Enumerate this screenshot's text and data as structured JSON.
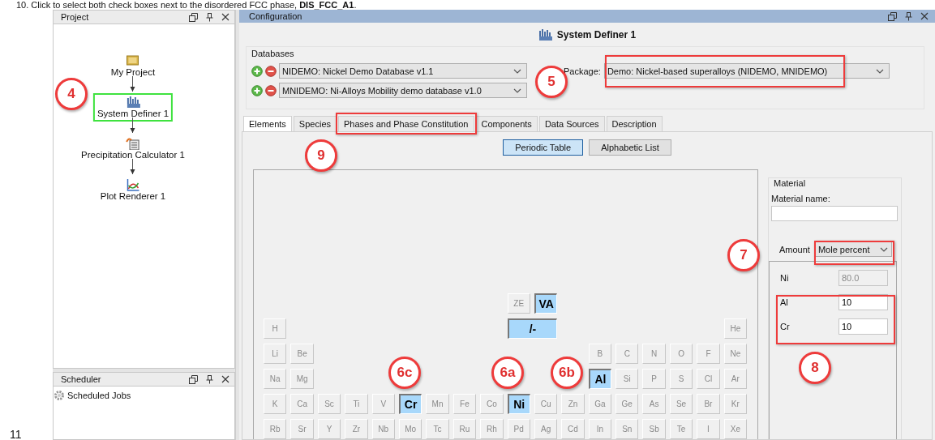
{
  "instruction_text": "10. Click to select both check boxes next to the disordered FCC phase, **DIS_FCC_A1**.",
  "page_number": "11",
  "project_panel": {
    "title": "Project",
    "nodes": [
      {
        "label": "My Project",
        "kind": "project",
        "selected": false
      },
      {
        "label": "System Definer 1",
        "kind": "definer",
        "selected": true
      },
      {
        "label": "Precipitation Calculator 1",
        "kind": "calculator",
        "selected": false
      },
      {
        "label": "Plot Renderer 1",
        "kind": "plot",
        "selected": false
      }
    ]
  },
  "scheduler_panel": {
    "title": "Scheduler",
    "items": [
      "Scheduled Jobs"
    ]
  },
  "configuration_panel": {
    "title": "Configuration",
    "header": "System Definer 1",
    "databases": {
      "title": "Databases",
      "rows": [
        {
          "value": "NIDEMO: Nickel Demo Database v1.1"
        },
        {
          "value": "MNIDEMO: Ni-Alloys Mobility demo database v1.0"
        }
      ]
    },
    "package": {
      "label": "Package:",
      "value": "Demo: Nickel-based superalloys (NIDEMO, MNIDEMO)"
    },
    "tabs": [
      {
        "label": "Elements",
        "selected": true
      },
      {
        "label": "Species",
        "selected": false
      },
      {
        "label": "Phases and Phase Constitution",
        "selected": false
      },
      {
        "label": "Components",
        "selected": false
      },
      {
        "label": "Data Sources",
        "selected": false
      },
      {
        "label": "Description",
        "selected": false
      }
    ],
    "view_buttons": [
      {
        "label": "Periodic Table",
        "selected": true
      },
      {
        "label": "Alphabetic List",
        "selected": false
      }
    ],
    "periodic_table": {
      "rows": [
        [
          "",
          "",
          "",
          "",
          "",
          "",
          "",
          "",
          "",
          {
            "symbol": "ZE",
            "kind": "special",
            "selected": false
          },
          {
            "symbol": "VA",
            "kind": "special",
            "selected": true
          }
        ],
        [
          {
            "symbol": "H",
            "kind": "element",
            "selected": false
          },
          "",
          "",
          "",
          "",
          "",
          "",
          "",
          "",
          {
            "symbol": "/-",
            "kind": "wide",
            "selected": true
          },
          "",
          "",
          "",
          "",
          "",
          "",
          "",
          {
            "symbol": "He",
            "kind": "element",
            "selected": false
          }
        ],
        [
          {
            "symbol": "Li",
            "kind": "element",
            "selected": false
          },
          {
            "symbol": "Be",
            "kind": "element",
            "selected": false
          },
          "",
          "",
          "",
          "",
          "",
          "",
          "",
          "",
          "",
          "",
          {
            "symbol": "B",
            "kind": "element",
            "selected": false
          },
          {
            "symbol": "C",
            "kind": "element",
            "selected": false
          },
          {
            "symbol": "N",
            "kind": "element",
            "selected": false
          },
          {
            "symbol": "O",
            "kind": "element",
            "selected": false
          },
          {
            "symbol": "F",
            "kind": "element",
            "selected": false
          },
          {
            "symbol": "Ne",
            "kind": "element",
            "selected": false
          }
        ],
        [
          {
            "symbol": "Na",
            "kind": "element",
            "selected": false
          },
          {
            "symbol": "Mg",
            "kind": "element",
            "selected": false
          },
          "",
          "",
          "",
          "",
          "",
          "",
          "",
          "",
          "",
          "",
          {
            "symbol": "Al",
            "kind": "element",
            "selected": true
          },
          {
            "symbol": "Si",
            "kind": "element",
            "selected": false
          },
          {
            "symbol": "P",
            "kind": "element",
            "selected": false
          },
          {
            "symbol": "S",
            "kind": "element",
            "selected": false
          },
          {
            "symbol": "Cl",
            "kind": "element",
            "selected": false
          },
          {
            "symbol": "Ar",
            "kind": "element",
            "selected": false
          }
        ],
        [
          {
            "symbol": "K",
            "kind": "element",
            "selected": false
          },
          {
            "symbol": "Ca",
            "kind": "element",
            "selected": false
          },
          {
            "symbol": "Sc",
            "kind": "element",
            "selected": false
          },
          {
            "symbol": "Ti",
            "kind": "element",
            "selected": false
          },
          {
            "symbol": "V",
            "kind": "element",
            "selected": false
          },
          {
            "symbol": "Cr",
            "kind": "element",
            "selected": true
          },
          {
            "symbol": "Mn",
            "kind": "element",
            "selected": false
          },
          {
            "symbol": "Fe",
            "kind": "element",
            "selected": false
          },
          {
            "symbol": "Co",
            "kind": "element",
            "selected": false
          },
          {
            "symbol": "Ni",
            "kind": "element",
            "selected": true
          },
          {
            "symbol": "Cu",
            "kind": "element",
            "selected": false
          },
          {
            "symbol": "Zn",
            "kind": "element",
            "selected": false
          },
          {
            "symbol": "Ga",
            "kind": "element",
            "selected": false
          },
          {
            "symbol": "Ge",
            "kind": "element",
            "selected": false
          },
          {
            "symbol": "As",
            "kind": "element",
            "selected": false
          },
          {
            "symbol": "Se",
            "kind": "element",
            "selected": false
          },
          {
            "symbol": "Br",
            "kind": "element",
            "selected": false
          },
          {
            "symbol": "Kr",
            "kind": "element",
            "selected": false
          }
        ],
        [
          {
            "symbol": "Rb",
            "kind": "element",
            "selected": false
          },
          {
            "symbol": "Sr",
            "kind": "element",
            "selected": false
          },
          {
            "symbol": "Y",
            "kind": "element",
            "selected": false
          },
          {
            "symbol": "Zr",
            "kind": "element",
            "selected": false
          },
          {
            "symbol": "Nb",
            "kind": "element",
            "selected": false
          },
          {
            "symbol": "Mo",
            "kind": "element",
            "selected": false
          },
          {
            "symbol": "Tc",
            "kind": "element",
            "selected": false
          },
          {
            "symbol": "Ru",
            "kind": "element",
            "selected": false
          },
          {
            "symbol": "Rh",
            "kind": "element",
            "selected": false
          },
          {
            "symbol": "Pd",
            "kind": "element",
            "selected": false
          },
          {
            "symbol": "Ag",
            "kind": "element",
            "selected": false
          },
          {
            "symbol": "Cd",
            "kind": "element",
            "selected": false
          },
          {
            "symbol": "In",
            "kind": "element",
            "selected": false
          },
          {
            "symbol": "Sn",
            "kind": "element",
            "selected": false
          },
          {
            "symbol": "Sb",
            "kind": "element",
            "selected": false
          },
          {
            "symbol": "Te",
            "kind": "element",
            "selected": false
          },
          {
            "symbol": "I",
            "kind": "element",
            "selected": false
          },
          {
            "symbol": "Xe",
            "kind": "element",
            "selected": false
          }
        ]
      ]
    },
    "material": {
      "title": "Material",
      "name_label": "Material name:",
      "amount_label": "Amount",
      "amount_unit": "Mole percent",
      "composition": [
        {
          "element": "Ni",
          "value": "80.0",
          "disabled": true
        },
        {
          "element": "Al",
          "value": "10",
          "disabled": false
        },
        {
          "element": "Cr",
          "value": "10",
          "disabled": false
        }
      ]
    }
  },
  "callouts": [
    {
      "label": "4"
    },
    {
      "label": "5"
    },
    {
      "label": "9"
    },
    {
      "label": "6c"
    },
    {
      "label": "6a"
    },
    {
      "label": "6b"
    },
    {
      "label": "7"
    },
    {
      "label": "8"
    }
  ]
}
